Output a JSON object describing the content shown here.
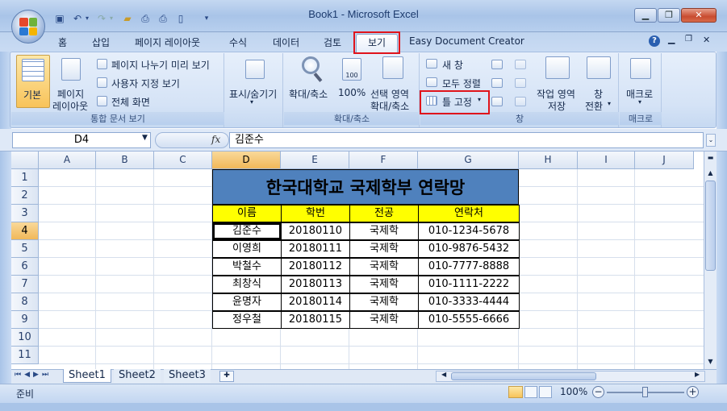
{
  "window": {
    "title": "Book1 - Microsoft Excel",
    "minimize": "▁",
    "restore": "❐",
    "close": "✕"
  },
  "tabs": [
    {
      "label": "홈"
    },
    {
      "label": "삽입"
    },
    {
      "label": "페이지 레이아웃"
    },
    {
      "label": "수식"
    },
    {
      "label": "데이터"
    },
    {
      "label": "검토"
    },
    {
      "label": "보기"
    },
    {
      "label": "Easy Document Creator"
    }
  ],
  "ribbon": {
    "workbook_views": {
      "group_label": "통합 문서 보기",
      "normal": "기본",
      "page_layout_1": "페이지",
      "page_layout_2": "레이아웃",
      "page_break": "페이지 나누기 미리 보기",
      "custom_views": "사용자 지정 보기",
      "full_screen": "전체 화면"
    },
    "show_hide": {
      "label": "표시/숨기기"
    },
    "zoom": {
      "group_label": "확대/축소",
      "zoom": "확대/축소",
      "hundred": "100%",
      "sel_1": "선택 영역",
      "sel_2": "확대/축소"
    },
    "window": {
      "group_label": "창",
      "new_window": "새 창",
      "arrange_all": "모두 정렬",
      "freeze_panes": "틀 고정",
      "save_ws_1": "작업 영역",
      "save_ws_2": "저장",
      "switch_1": "창",
      "switch_2": "전환"
    },
    "macros": {
      "group_label": "매크로",
      "macro": "매크로"
    }
  },
  "formula_bar": {
    "name_box": "D4",
    "fx": "fx",
    "value": "김준수"
  },
  "columns": [
    "A",
    "B",
    "C",
    "D",
    "E",
    "F",
    "G",
    "H",
    "I",
    "J"
  ],
  "rows": [
    "1",
    "2",
    "3",
    "4",
    "5",
    "6",
    "7",
    "8",
    "9",
    "10",
    "11"
  ],
  "sheet": {
    "title": "한국대학교 국제학부 연락망",
    "headers": [
      "이름",
      "학번",
      "전공",
      "연락처"
    ],
    "records": [
      [
        "김준수",
        "20180110",
        "국제학",
        "010-1234-5678"
      ],
      [
        "이영희",
        "20180111",
        "국제학",
        "010-9876-5432"
      ],
      [
        "박철수",
        "20180112",
        "국제학",
        "010-7777-8888"
      ],
      [
        "최창식",
        "20180113",
        "국제학",
        "010-1111-2222"
      ],
      [
        "윤명자",
        "20180114",
        "국제학",
        "010-3333-4444"
      ],
      [
        "정우철",
        "20180115",
        "국제학",
        "010-5555-6666"
      ]
    ]
  },
  "sheet_tabs": [
    "Sheet1",
    "Sheet2",
    "Sheet3"
  ],
  "status": {
    "ready": "준비",
    "zoom": "100%"
  },
  "colors": {
    "title_fill": "#4f81bd",
    "header_fill": "#ffff00",
    "highlight": "#e0141b"
  }
}
